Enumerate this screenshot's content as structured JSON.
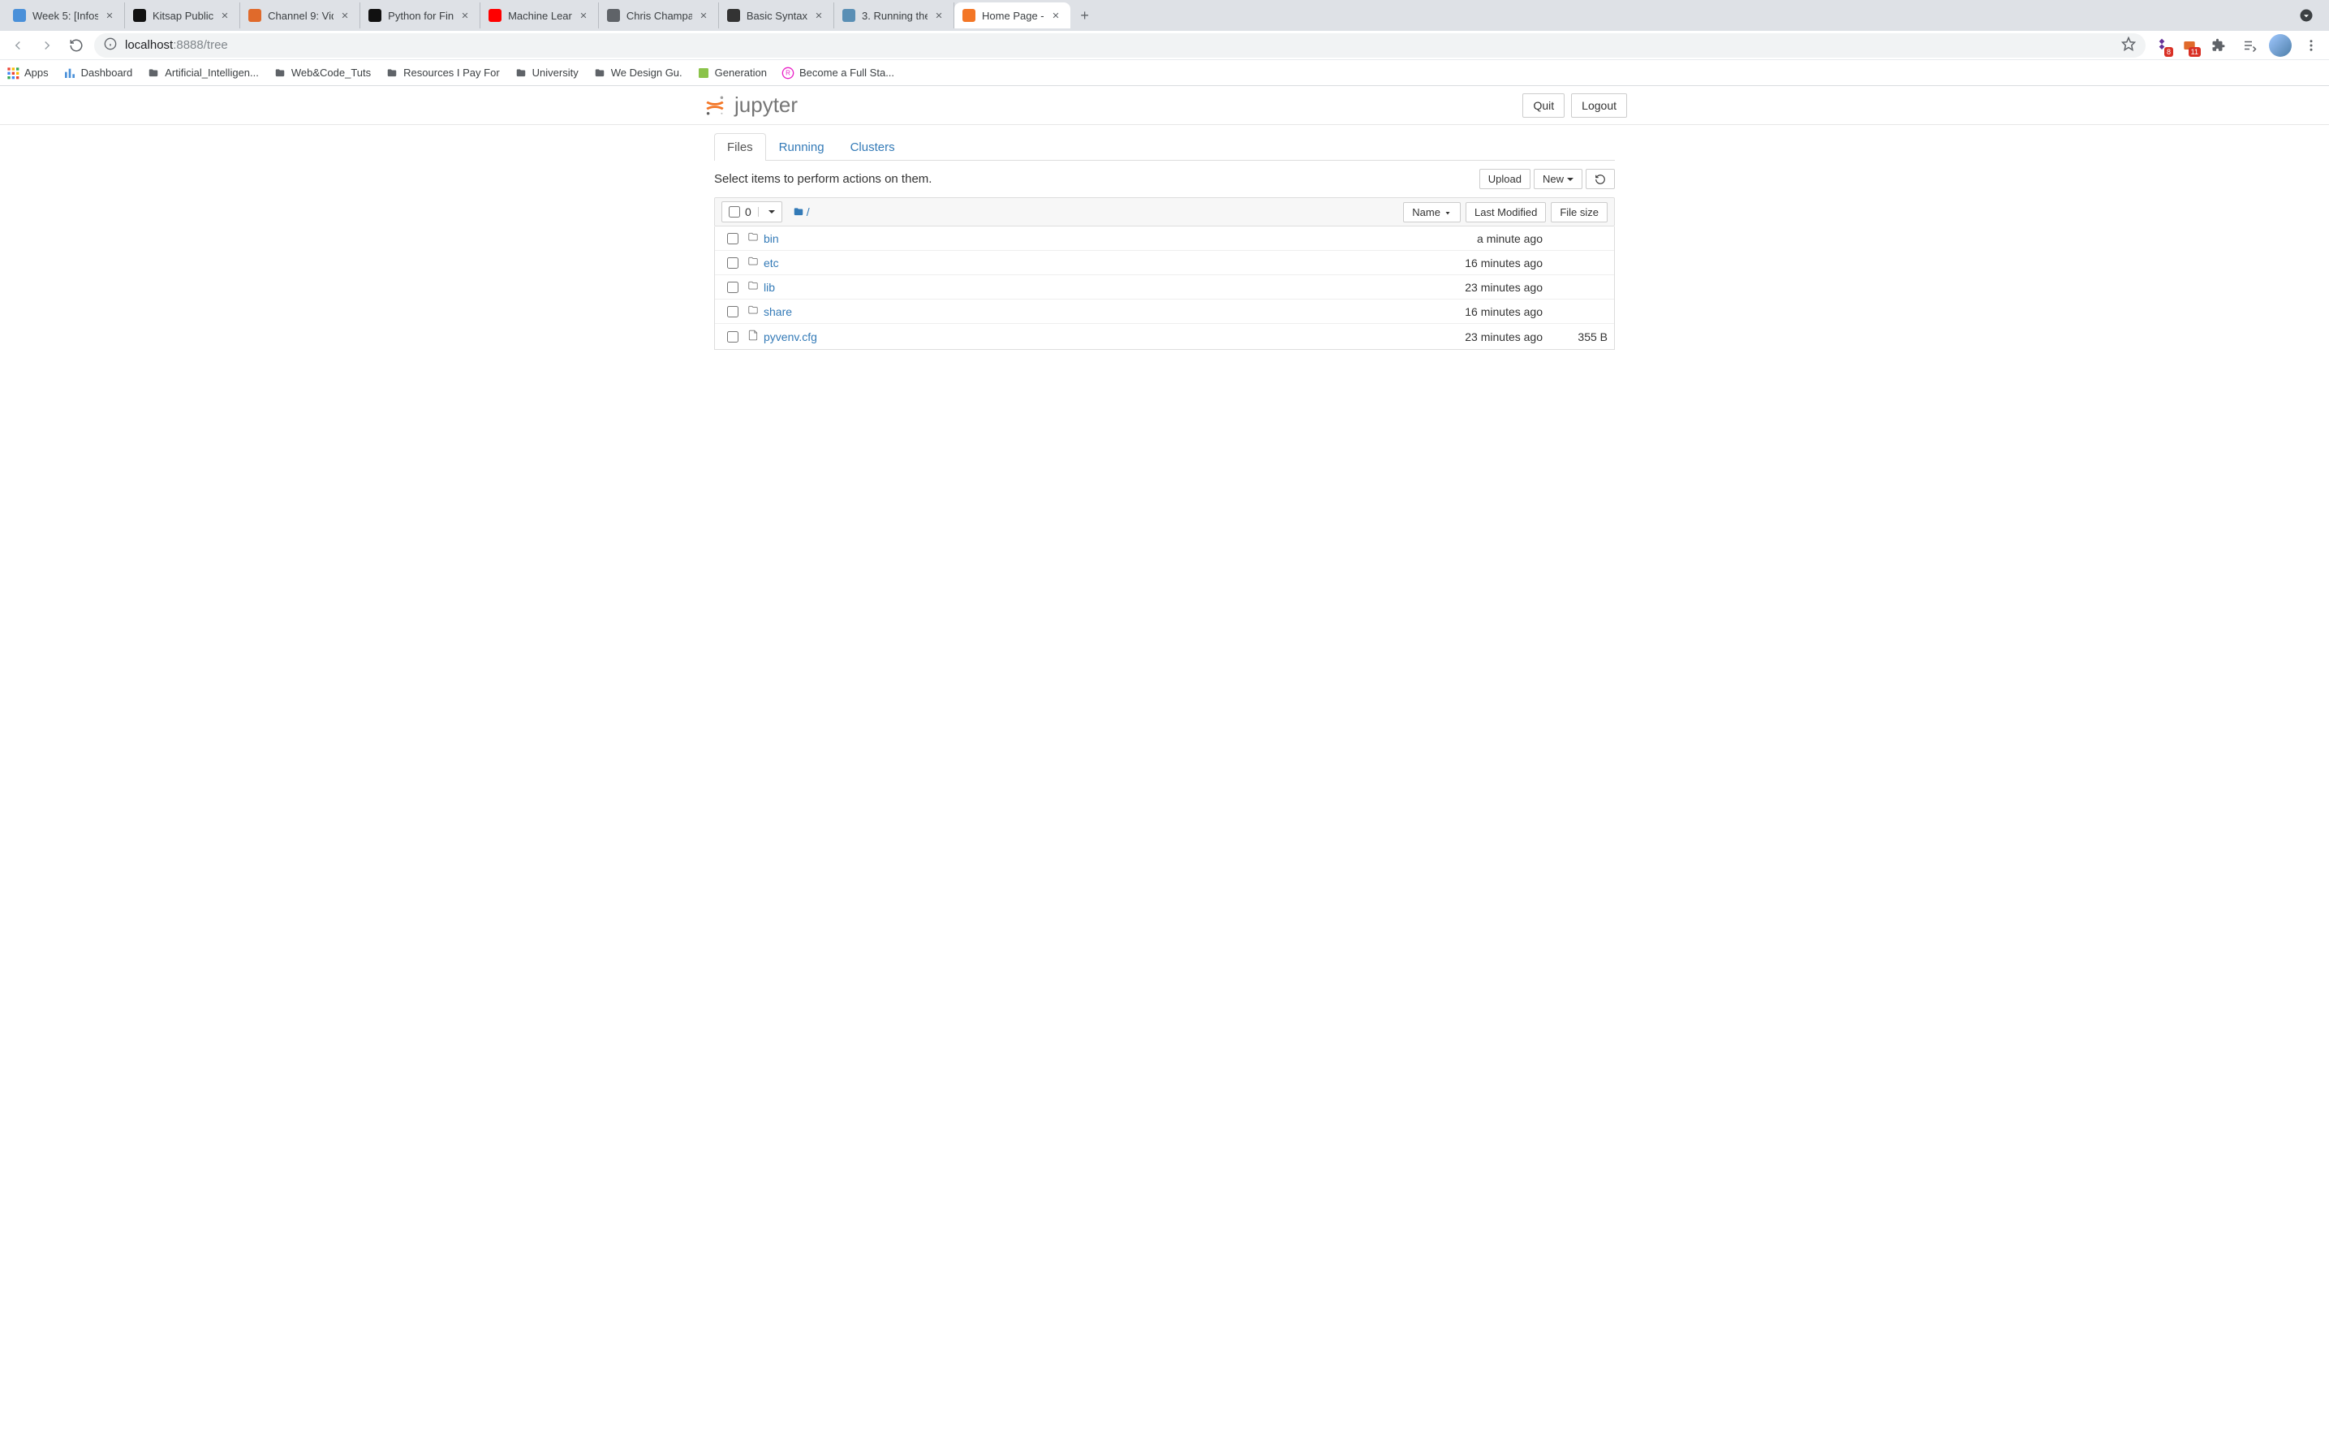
{
  "browser": {
    "tabs": [
      {
        "title": "Week 5: [Infos",
        "favicon_color": "#4a90d9"
      },
      {
        "title": "Kitsap Public",
        "favicon_color": "#111"
      },
      {
        "title": "Channel 9: Vid",
        "favicon_color": "#e06a2b"
      },
      {
        "title": "Python for Fin",
        "favicon_color": "#111"
      },
      {
        "title": "Machine Lear",
        "favicon_color": "#ff0000"
      },
      {
        "title": "Chris Champa",
        "favicon_color": "#5f6368"
      },
      {
        "title": "Basic Syntax",
        "favicon_color": "#333"
      },
      {
        "title": "3. Running the",
        "favicon_color": "#5a8fb5"
      },
      {
        "title": "Home Page -",
        "favicon_color": "#f37626",
        "active": true
      }
    ],
    "url_display": "localhost:8888/tree",
    "url_dim_prefix": "localhost",
    "url_rest": ":8888/tree",
    "ext_badge_1": "8",
    "ext_badge_2": "11"
  },
  "bookmarks": [
    {
      "label": "Apps",
      "icon": "apps-grid-icon",
      "color": "#ea4335"
    },
    {
      "label": "Dashboard",
      "icon": "bars-icon",
      "color": "#4a90d9"
    },
    {
      "label": "Artificial_Intelligen...",
      "icon": "folder-icon"
    },
    {
      "label": "Web&Code_Tuts",
      "icon": "folder-icon"
    },
    {
      "label": "Resources I Pay For",
      "icon": "folder-icon"
    },
    {
      "label": "University",
      "icon": "folder-icon"
    },
    {
      "label": "We Design Gu.",
      "icon": "folder-icon"
    },
    {
      "label": "Generation",
      "icon": "square-icon",
      "color": "#8bc34a"
    },
    {
      "label": "Become a Full Sta...",
      "icon": "circle-r-icon",
      "color": "#e91fc7"
    }
  ],
  "jupyter": {
    "logo_text": "jupyter",
    "quit_label": "Quit",
    "logout_label": "Logout",
    "tabs": {
      "files": "Files",
      "running": "Running",
      "clusters": "Clusters"
    },
    "hint": "Select items to perform actions on them.",
    "upload_label": "Upload",
    "new_label": "New",
    "select_count": "0",
    "breadcrumb_root": "/",
    "sort": {
      "name": "Name",
      "modified": "Last Modified",
      "size": "File size"
    },
    "items": [
      {
        "type": "folder",
        "name": "bin",
        "modified": "a minute ago",
        "size": ""
      },
      {
        "type": "folder",
        "name": "etc",
        "modified": "16 minutes ago",
        "size": ""
      },
      {
        "type": "folder",
        "name": "lib",
        "modified": "23 minutes ago",
        "size": ""
      },
      {
        "type": "folder",
        "name": "share",
        "modified": "16 minutes ago",
        "size": ""
      },
      {
        "type": "file",
        "name": "pyvenv.cfg",
        "modified": "23 minutes ago",
        "size": "355 B"
      }
    ]
  }
}
